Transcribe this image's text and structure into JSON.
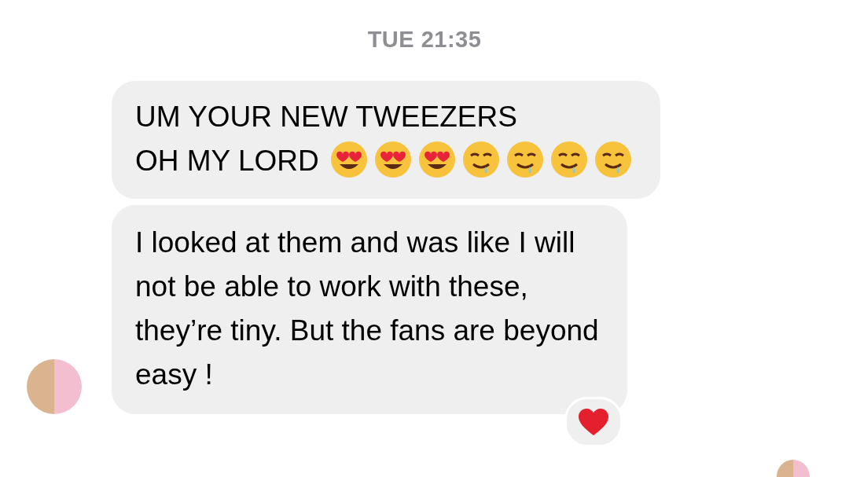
{
  "timestamp": "TUE 21:35",
  "messages": [
    {
      "text": "UM YOUR NEW TWEEZERS\nOH MY LORD",
      "emojis": [
        {
          "kind": "heart-eyes"
        },
        {
          "kind": "heart-eyes"
        },
        {
          "kind": "heart-eyes"
        },
        {
          "kind": "drooling"
        },
        {
          "kind": "drooling"
        },
        {
          "kind": "drooling"
        },
        {
          "kind": "drooling"
        }
      ]
    },
    {
      "text": "I looked at them and was like I will\nnot be able to work with these,\nthey’re tiny. But the fans are beyond\neasy !",
      "reaction": {
        "kind": "heart"
      }
    }
  ]
}
